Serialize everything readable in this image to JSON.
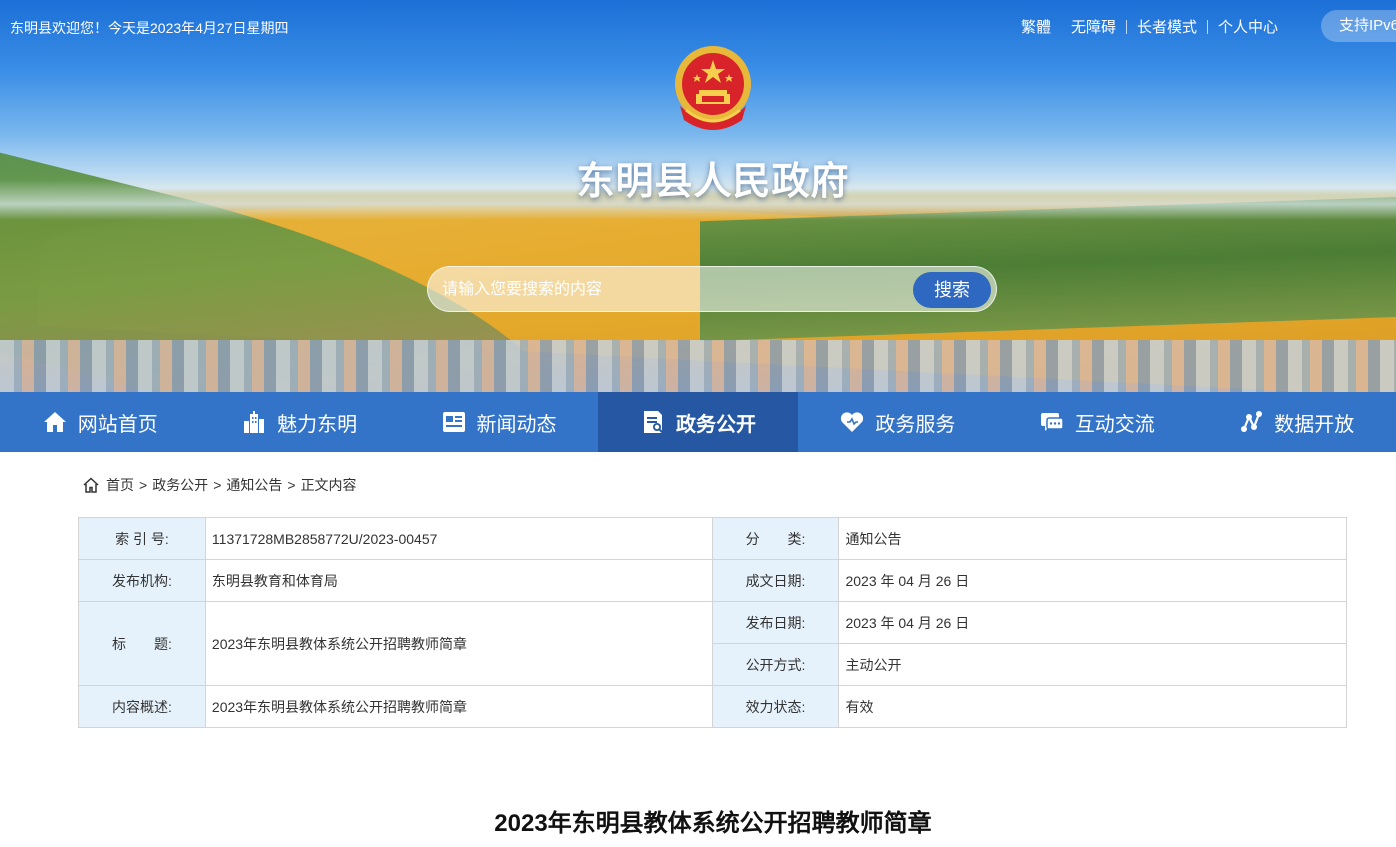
{
  "header": {
    "welcome": "东明县欢迎您！今天是2023年4月27日星期四",
    "links": [
      "繁體",
      "无障碍",
      "长者模式",
      "个人中心"
    ],
    "ipv6_label": "支持IPv6",
    "site_title": "东明县人民政府"
  },
  "search": {
    "placeholder": "请输入您要搜索的内容",
    "button_label": "搜索"
  },
  "nav": {
    "items": [
      {
        "label": "网站首页",
        "icon": "home-icon"
      },
      {
        "label": "魅力东明",
        "icon": "city-icon"
      },
      {
        "label": "新闻动态",
        "icon": "news-icon"
      },
      {
        "label": "政务公开",
        "icon": "document-icon",
        "active": true
      },
      {
        "label": "政务服务",
        "icon": "heart-icon"
      },
      {
        "label": "互动交流",
        "icon": "chat-icon"
      },
      {
        "label": "数据开放",
        "icon": "data-share-icon"
      }
    ]
  },
  "breadcrumb": {
    "items": [
      "首页",
      "政务公开",
      "通知公告",
      "正文内容"
    ],
    "separator": ">"
  },
  "info_table": {
    "index_label": "索 引 号:",
    "index_value": "11371728MB2858772U/2023-00457",
    "category_label": "分　　类:",
    "category_value": "通知公告",
    "publisher_label": "发布机构:",
    "publisher_value": "东明县教育和体育局",
    "written_date_label": "成文日期:",
    "written_date_value": "2023 年 04 月 26 日",
    "title_label": "标　　题:",
    "title_value": "2023年东明县教体系统公开招聘教师简章",
    "publish_date_label": "发布日期:",
    "publish_date_value": "2023 年 04 月 26 日",
    "disclosure_label": "公开方式:",
    "disclosure_value": "主动公开",
    "summary_label": "内容概述:",
    "summary_value": "2023年东明县教体系统公开招聘教师简章",
    "status_label": "效力状态:",
    "status_value": "有效"
  },
  "article": {
    "title": "2023年东明县教体系统公开招聘教师简章"
  },
  "colors": {
    "nav_bg": "#3474c8",
    "nav_active": "#2557a3",
    "label_bg": "#e6f2fb"
  }
}
